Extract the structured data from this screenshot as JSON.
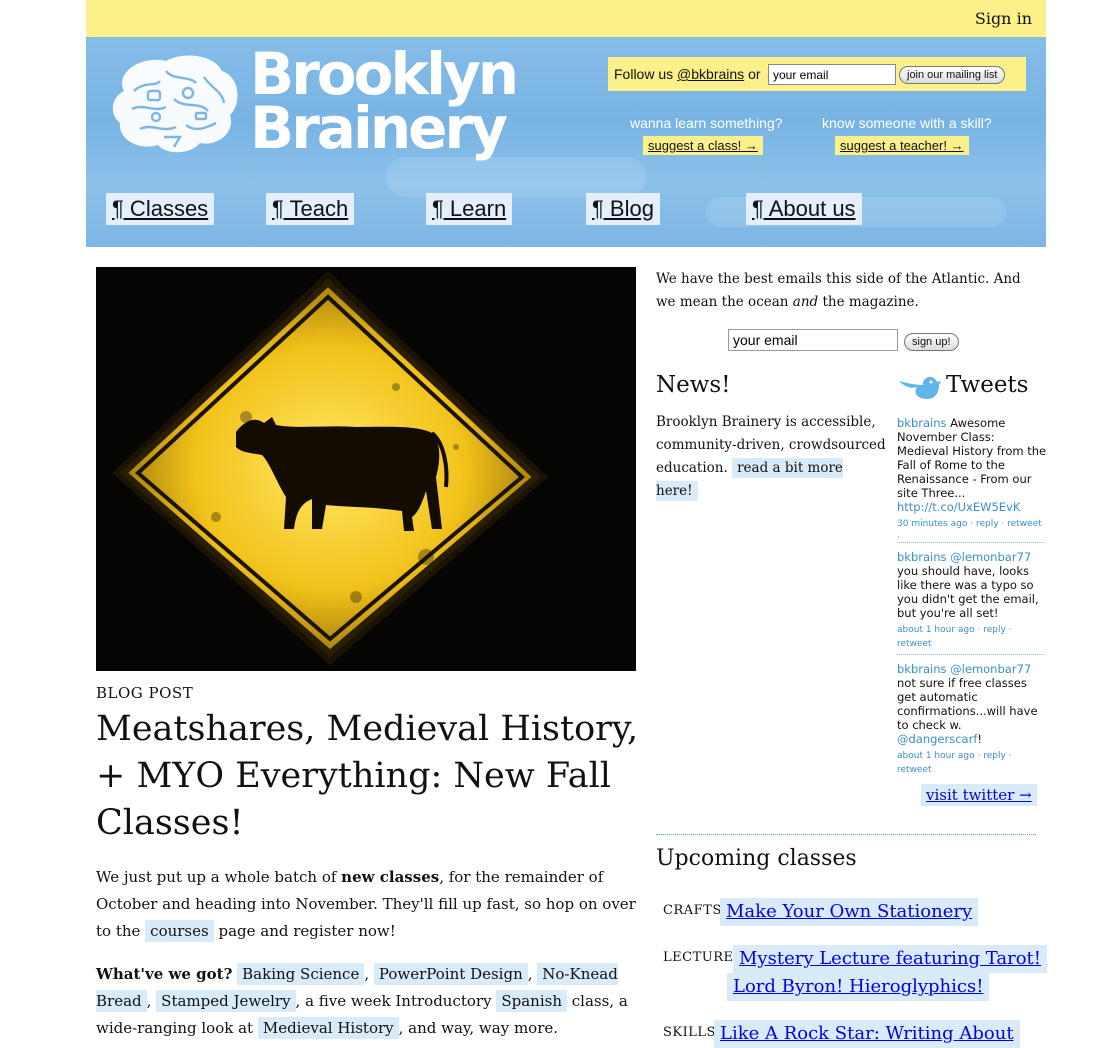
{
  "topbar": {
    "sign_in": "Sign in"
  },
  "brand": {
    "line1": "Brooklyn",
    "line2": "Brainery"
  },
  "follow": {
    "prefix": "Follow us",
    "handle": "@bkbrains",
    "or": "or",
    "email_value": "your email",
    "join_button": "join our mailing list"
  },
  "cta": {
    "learn_question": "wanna learn something?",
    "learn_link": "suggest a class! →",
    "teach_question": "know someone with a skill?",
    "teach_link": "suggest a teacher! →"
  },
  "nav": [
    {
      "label": "¶ Classes"
    },
    {
      "label": "¶ Teach"
    },
    {
      "label": "¶ Learn"
    },
    {
      "label": "¶ Blog"
    },
    {
      "label": "¶ About us"
    }
  ],
  "post": {
    "kicker": "BLOG POST",
    "title": "Meatshares, Medieval History, + MYO Everything: New Fall Classes!",
    "p1_a": "We just put up a whole batch of ",
    "p1_bold": "new classes",
    "p1_b": ", for the remainder of October and heading into November. They'll fill up fast, so hop on over to the ",
    "p1_link": "courses",
    "p1_c": " page and register now!",
    "p2_bold": "What've we got?",
    "p2_links": [
      "Baking Science",
      "PowerPoint Design",
      "No-Knead Bread",
      "Stamped Jewelry",
      "Spanish",
      "Medieval History"
    ],
    "p2_t1": " a five week Introductory ",
    "p2_t2": " class, a wide-ranging look at ",
    "p2_t3": ", and way, way more."
  },
  "newsletter": {
    "intro_a": "We have the best emails this side of the Atlantic. And we mean the ocean ",
    "intro_em": "and",
    "intro_b": " the magazine.",
    "email_value": "your email",
    "signup_button": "sign up!"
  },
  "news": {
    "heading": "News!",
    "text": "Brooklyn Brainery is accessible, community-driven, crowdsourced education.",
    "link": "read a bit more here!"
  },
  "tweets": {
    "heading": "Tweets",
    "items": [
      {
        "user": "bkbrains",
        "text": "Awesome November Class: Medieval History from the Fall of Rome to the Renaissance - From our site Three...",
        "link": "http://t.co/UxEW5EvK",
        "time": "30 minutes ago",
        "reply": "reply",
        "retweet": "retweet"
      },
      {
        "user": "bkbrains",
        "mention": "@lemonbar77",
        "text": "you should have, looks like there was a typo so you didn't get the email, but you're all set!",
        "time": "about 1 hour ago",
        "reply": "reply",
        "retweet": "retweet"
      },
      {
        "user": "bkbrains",
        "mention": "@lemonbar77",
        "text": "not sure if free classes get automatic confirmations...will have to check w.",
        "mention2": "@dangerscarf",
        "text2": "!",
        "time": "about 1 hour ago",
        "reply": "reply",
        "retweet": "retweet"
      }
    ],
    "visit": "visit twitter →"
  },
  "upcoming": {
    "heading": "Upcoming classes",
    "items": [
      {
        "category": "CRAFTS",
        "title": "Make Your Own Stationery"
      },
      {
        "category": "LECTURE",
        "title_line1": "Mystery Lecture featuring Tarot!",
        "title_line2": "Lord Byron! Hieroglyphics!"
      },
      {
        "category": "SKILLS",
        "title": "Like A Rock Star: Writing About"
      }
    ]
  },
  "colors": {
    "yellow": "#fcf08a",
    "sky": "#7db6e4",
    "highlight": "#d9eaf8",
    "link_blue": "#3a8ed0"
  }
}
